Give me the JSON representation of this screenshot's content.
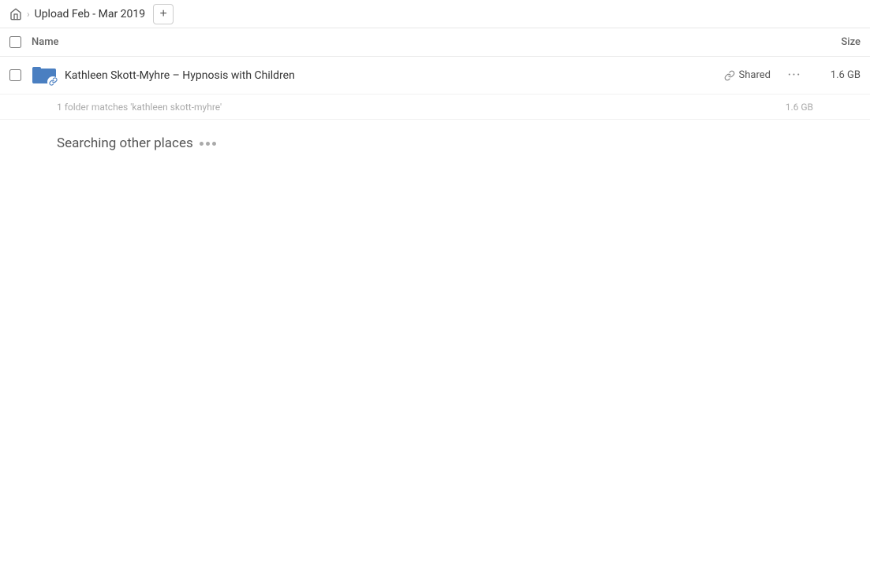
{
  "breadcrumb": {
    "home_label": "Home",
    "title": "Upload Feb - Mar 2019",
    "add_button_label": "+"
  },
  "columns": {
    "name_label": "Name",
    "size_label": "Size"
  },
  "file_row": {
    "name": "Kathleen Skott-Myhre – Hypnosis with Children",
    "shared_label": "Shared",
    "size": "1.6 GB",
    "more_label": "···"
  },
  "match_info": {
    "text": "1 folder matches 'kathleen skott-myhre'",
    "size": "1.6 GB"
  },
  "searching": {
    "label": "Searching other places"
  },
  "icons": {
    "home": "🏠",
    "chevron": "›",
    "link": "🔗"
  }
}
